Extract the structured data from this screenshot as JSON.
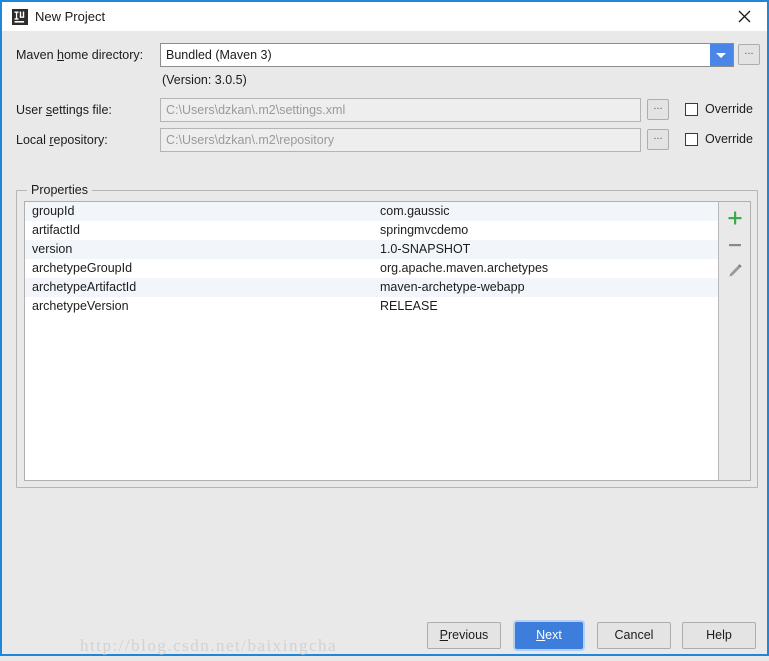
{
  "window": {
    "title": "New Project",
    "icon": "intellij-idea-icon",
    "close_icon": "close-icon",
    "accent_color": "#1e87d8",
    "background": "#e9e9e9"
  },
  "form": {
    "maven_home": {
      "label_pre": "Maven ",
      "label_mnemonic": "h",
      "label_post": "ome directory:",
      "value": "Bundled (Maven 3)",
      "dropdown_icon": "chevron-down-icon",
      "browse_label": "...",
      "version_note": "(Version: 3.0.5)"
    },
    "user_settings": {
      "label_pre": "User ",
      "label_mnemonic": "s",
      "label_post": "ettings file:",
      "value": "C:\\Users\\dzkan\\.m2\\settings.xml",
      "browse_label": "...",
      "override_label": "Override",
      "override_checked": false
    },
    "local_repository": {
      "label_pre": "Local ",
      "label_mnemonic": "r",
      "label_post": "epository:",
      "value": "C:\\Users\\dzkan\\.m2\\repository",
      "browse_label": "...",
      "override_label": "Override",
      "override_checked": false
    }
  },
  "properties": {
    "group_title": "Properties",
    "rows": [
      {
        "key": "groupId",
        "value": "com.gaussic"
      },
      {
        "key": "artifactId",
        "value": "springmvcdemo"
      },
      {
        "key": "version",
        "value": "1.0-SNAPSHOT"
      },
      {
        "key": "archetypeGroupId",
        "value": "org.apache.maven.archetypes"
      },
      {
        "key": "archetypeArtifactId",
        "value": "maven-archetype-webapp"
      },
      {
        "key": "archetypeVersion",
        "value": "RELEASE"
      }
    ],
    "toolbar": {
      "add_icon": "plus-icon",
      "add_color": "#3cab4a",
      "remove_icon": "minus-icon",
      "edit_icon": "pencil-icon"
    }
  },
  "footer": {
    "previous": {
      "pre": "",
      "mnemonic": "P",
      "post": "revious"
    },
    "next": {
      "pre": "",
      "mnemonic": "N",
      "post": "ext"
    },
    "cancel": {
      "label": "Cancel"
    },
    "help": {
      "label": "Help"
    },
    "watermark": "http://blog.csdn.net/baixingcha"
  }
}
